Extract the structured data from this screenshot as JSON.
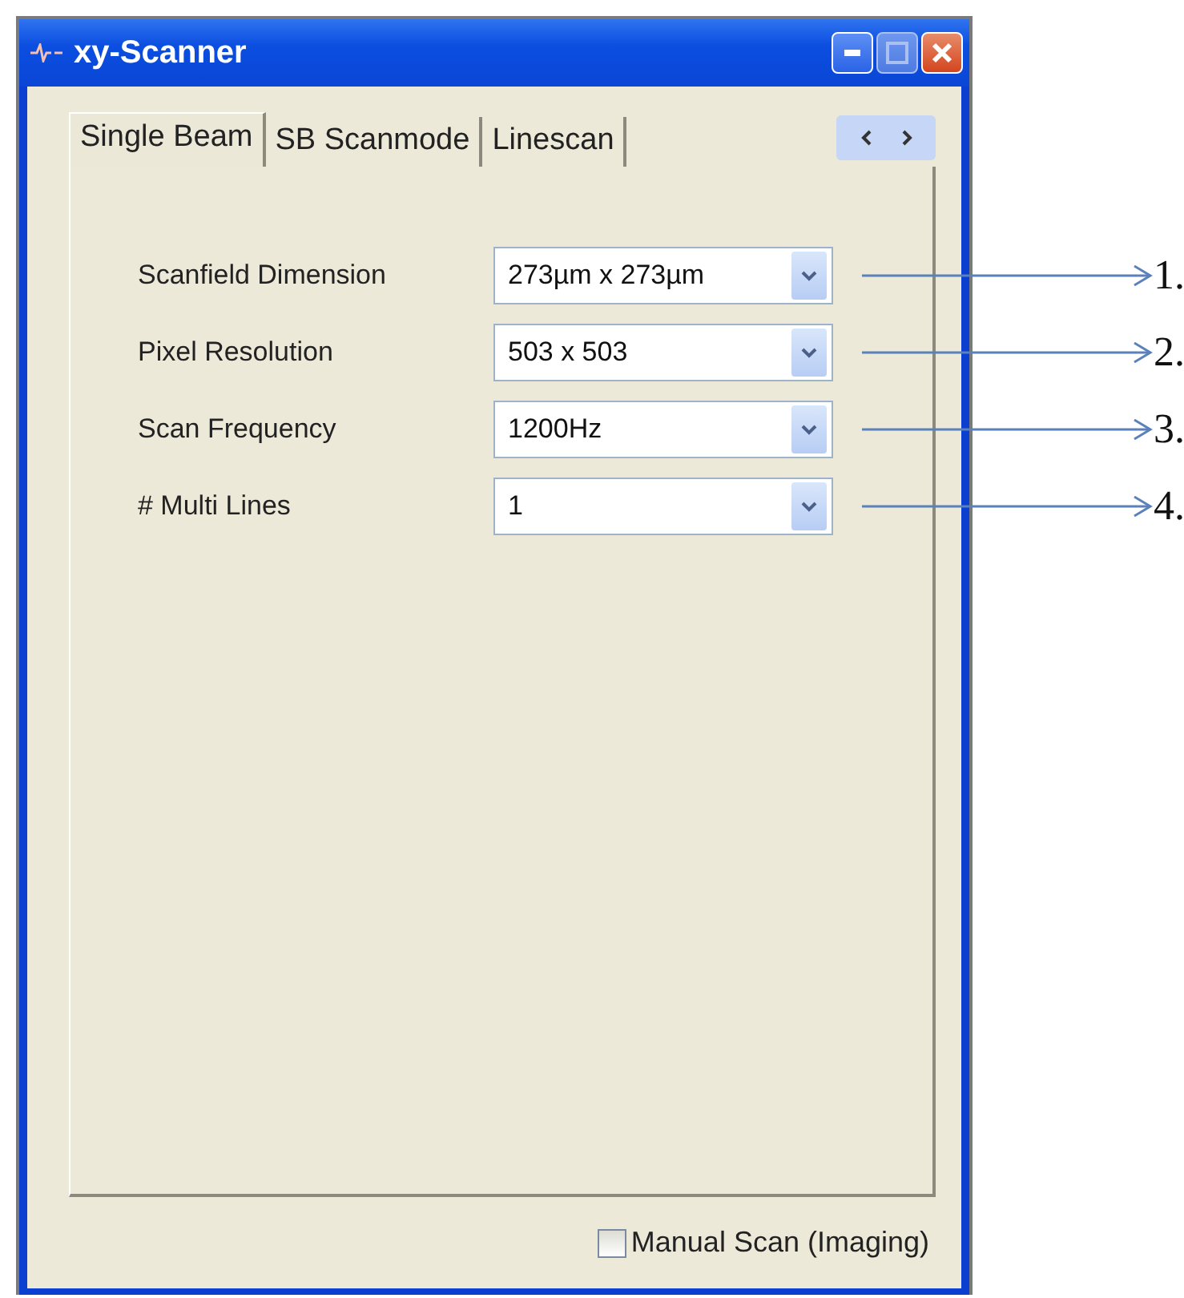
{
  "window": {
    "title": "xy-Scanner"
  },
  "tabs": [
    {
      "label": "Single Beam",
      "selected": true
    },
    {
      "label": "SB Scanmode",
      "selected": false
    },
    {
      "label": "Linescan",
      "selected": false
    }
  ],
  "fields": [
    {
      "label": "Scanfield Dimension",
      "value": "273µm x 273µm",
      "annotation": "1."
    },
    {
      "label": "Pixel Resolution",
      "value": "503 x 503",
      "annotation": "2."
    },
    {
      "label": "Scan Frequency",
      "value": "1200Hz",
      "annotation": "3."
    },
    {
      "label": "# Multi Lines",
      "value": "1",
      "annotation": "4."
    }
  ],
  "checkbox": {
    "label": "Manual Scan (Imaging)",
    "checked": false
  }
}
